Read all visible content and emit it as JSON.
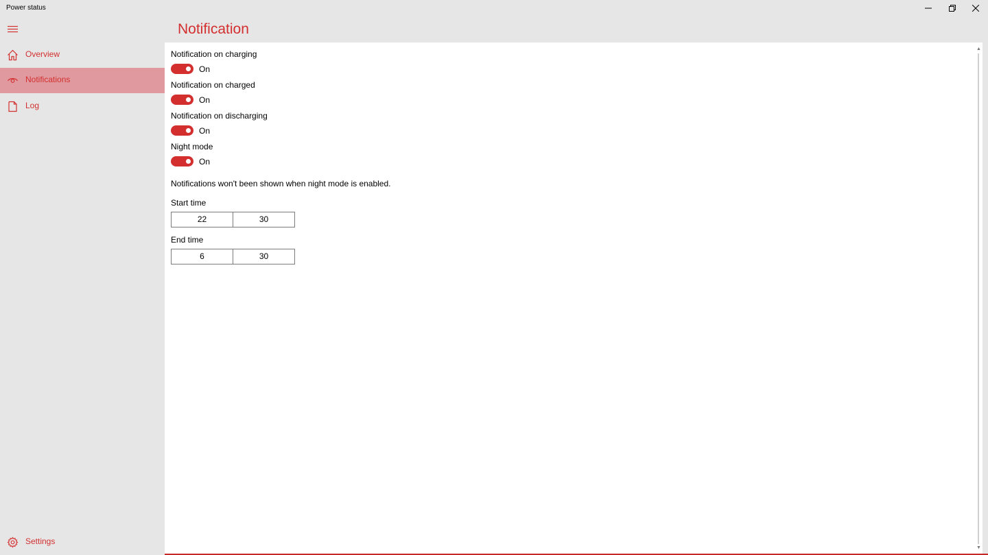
{
  "window": {
    "title": "Power status",
    "minimize_icon": "minimize-icon",
    "maximize_icon": "restore-icon",
    "close_icon": "close-icon"
  },
  "sidebar": {
    "menu_icon": "hamburger-icon",
    "items": [
      {
        "label": "Overview",
        "icon": "home-icon",
        "selected": false
      },
      {
        "label": "Notifications",
        "icon": "eye-icon",
        "selected": true
      },
      {
        "label": "Log",
        "icon": "document-icon",
        "selected": false
      }
    ],
    "settings": {
      "label": "Settings",
      "icon": "gear-icon"
    }
  },
  "header": {
    "title": "Notification"
  },
  "settings": [
    {
      "label": "Notification on charging",
      "state": "On",
      "enabled": true
    },
    {
      "label": "Notification on charged",
      "state": "On",
      "enabled": true
    },
    {
      "label": "Notification on discharging",
      "state": "On",
      "enabled": true
    },
    {
      "label": "Night mode",
      "state": "On",
      "enabled": true
    }
  ],
  "note": "Notifications won't been shown when night mode is enabled.",
  "start_time": {
    "label": "Start time",
    "hour": "22",
    "minute": "30"
  },
  "end_time": {
    "label": "End time",
    "hour": "6",
    "minute": "30"
  },
  "colors": {
    "accent": "#d32f2f",
    "selected_nav_bg": "#e09a9f",
    "chrome_bg": "#e6e6e6",
    "content_bg": "#ffffff"
  }
}
